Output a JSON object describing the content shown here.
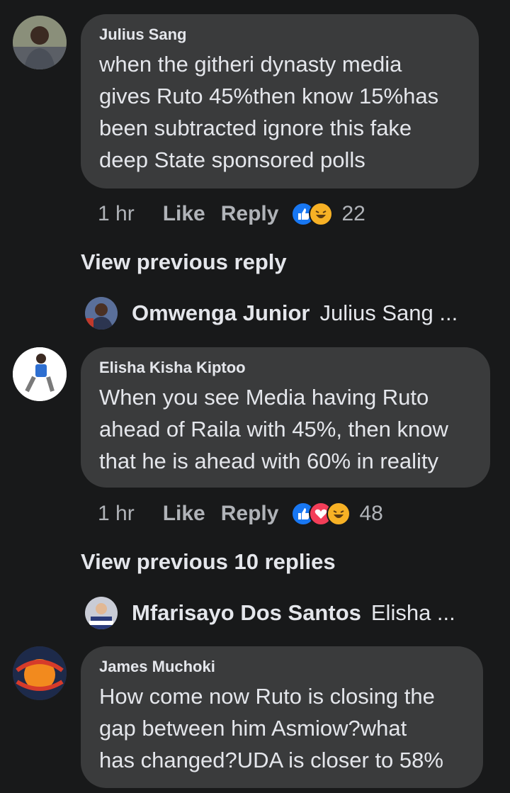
{
  "comments": [
    {
      "author": "Julius Sang",
      "text": "when the githeri dynasty media\ngives Ruto 45%then know 15%has\nbeen subtracted ignore this fake\ndeep State sponsored polls",
      "time": "1 hr",
      "like_label": "Like",
      "reply_label": "Reply",
      "reactions": [
        "like-icon",
        "haha-icon"
      ],
      "reaction_count": "22"
    },
    {
      "author": "Elisha Kisha Kiptoo",
      "text": "When you see Media having Ruto\nahead of Raila with 45%, then know\nthat he is ahead with 60% in reality",
      "time": "1 hr",
      "like_label": "Like",
      "reply_label": "Reply",
      "reactions": [
        "like-icon",
        "love-icon",
        "haha-icon"
      ],
      "reaction_count": "48"
    },
    {
      "author": "James Muchoki",
      "text": "How come now Ruto is closing the\ngap between him Asmiow?what\nhas changed?UDA is closer to 58%"
    }
  ],
  "view_previous": [
    {
      "label": "View previous reply"
    },
    {
      "label": "View previous 10 replies"
    }
  ],
  "reply_previews": [
    {
      "name": "Omwenga Junior",
      "preview": "Julius Sang ..."
    },
    {
      "name": "Mfarisayo Dos Santos",
      "preview": "Elisha ..."
    }
  ],
  "colors": {
    "background": "#18191a",
    "bubble": "#3a3b3c",
    "text": "#e4e6eb",
    "muted": "#b0b3b8",
    "like": "#1877f2",
    "love": "#f33e58",
    "haha": "#f7b125"
  }
}
